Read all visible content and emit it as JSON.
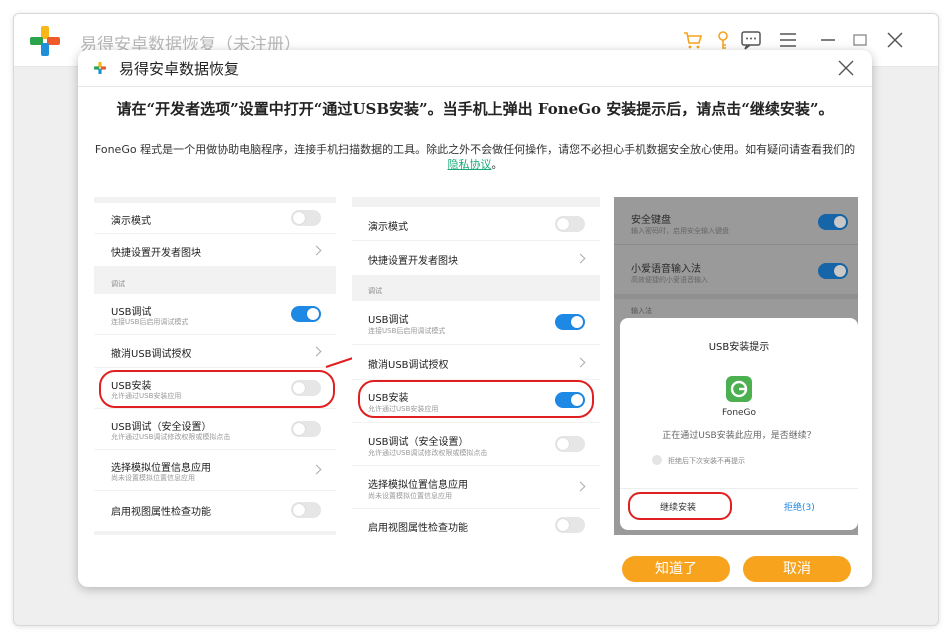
{
  "app": {
    "title": "易得安卓数据恢复（未注册）",
    "icons": [
      "cart-icon",
      "key-icon",
      "feedback-icon",
      "menu-icon",
      "minimize-icon",
      "maximize-icon",
      "close-icon"
    ]
  },
  "dialog": {
    "title": "易得安卓数据恢复",
    "instruction_main": "请在“开发者选项”设置中打开“通过USB安装”。当手机上弹出 FoneGo 安装提示后，请点击“继续安装”。",
    "instruction_sub_before": "FoneGo 程式是一个用做协助电脑程序，连接手机扫描数据的工具。除此之外不会做任何操作，请您不必担心手机数据安全放心使用。如有疑问请查看我们的",
    "privacy_link": "隐私协议",
    "instruction_sub_after": "。",
    "ok_button": "知道了",
    "cancel_button": "取消"
  },
  "left_panel": {
    "rows": [
      {
        "title": "演示模式"
      },
      {
        "title": "快捷设置开发者图块"
      },
      {
        "title": "USB调试",
        "desc": "连接USB后启用调试模式"
      },
      {
        "title": "撤消USB调试授权"
      },
      {
        "title": "USB安装",
        "desc": "允许通过USB安装应用"
      },
      {
        "title": "USB调试（安全设置）",
        "desc": "允许通过USB调试修改权限或模拟点击"
      },
      {
        "title": "选择模拟位置信息应用",
        "desc": "尚未设置模拟位置信息应用"
      },
      {
        "title": "启用视图属性检查功能"
      }
    ],
    "section_label": "调试"
  },
  "mid_panel": {
    "rows": [
      {
        "title": "演示模式"
      },
      {
        "title": "快捷设置开发者图块"
      },
      {
        "title": "USB调试",
        "desc": "连接USB后启用调试模式"
      },
      {
        "title": "撤消USB调试授权"
      },
      {
        "title": "USB安装",
        "desc": "允许通过USB安装应用"
      },
      {
        "title": "USB调试（安全设置）",
        "desc": "允许通过USB调试修改权限或模拟点击"
      },
      {
        "title": "选择模拟位置信息应用",
        "desc": "尚未设置模拟位置信息应用"
      },
      {
        "title": "启用视图属性检查功能"
      }
    ],
    "section_label": "调试"
  },
  "phone": {
    "row1_title": "安全键盘",
    "row1_desc": "输入密码时，启用安全输入键盘",
    "row2_title": "小爱语音输入法",
    "row2_desc": "高效便捷的小爱语音输入",
    "section_label": "输入法",
    "popup_title": "USB安装提示",
    "app_name": "FoneGo",
    "question": "正在通过USB安装此应用，是否继续？",
    "checkbox_label": "拒绝后下次安装不再提示",
    "continue_button": "继续安装",
    "reject_button": "拒绝(3)"
  },
  "colors": {
    "accent_orange": "#f7a31e",
    "toggle_blue": "#1e88e5",
    "highlight_red": "#e02020",
    "link_green": "#1aa87a"
  }
}
